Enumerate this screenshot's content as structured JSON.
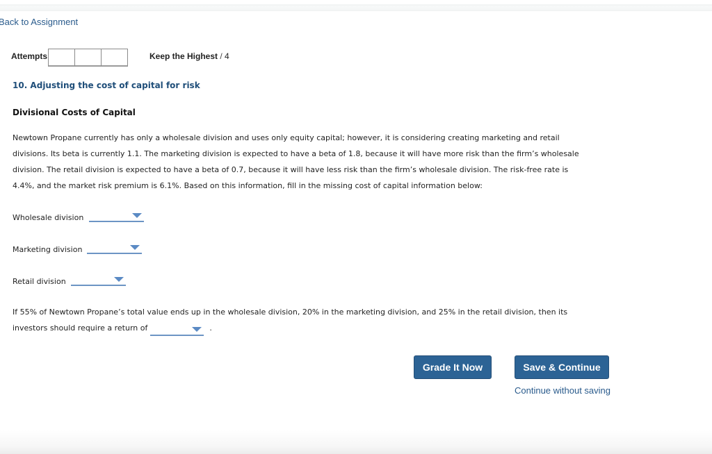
{
  "nav": {
    "back_link": "Back to Assignment"
  },
  "attempts": {
    "label": "Attempts",
    "boxes": [
      "",
      "",
      ""
    ],
    "policy_label": "Keep the Highest",
    "separator": " / ",
    "max_attempts": "4"
  },
  "question": {
    "title": "10. Adjusting the cost of capital for risk",
    "section_title": "Divisional Costs of Capital",
    "paragraph_lines": [
      "Newtown Propane currently has only a wholesale division and uses only equity capital; however, it is considering creating marketing and retail",
      "divisions. Its beta is currently 1.1. The marketing division is expected to have a beta of 1.8, because it will have more risk than the firm’s wholesale",
      "division. The retail division is expected to have a beta of 0.7, because it will have less risk than the firm’s wholesale division. The risk-free rate is",
      "4.4%, and the market risk premium is 6.1%. Based on this information, fill in the missing cost of capital information below:"
    ],
    "fields": [
      {
        "label": "Wholesale division",
        "selected": ""
      },
      {
        "label": "Marketing division",
        "selected": ""
      },
      {
        "label": "Retail division",
        "selected": ""
      }
    ],
    "weights_line1": "If 55% of Newtown Propane’s total value ends up in the wholesale division, 20% in the marketing division, and 25% in the retail division, then its",
    "weights_line2_prefix": "investors should require a return of",
    "weights_selected": "",
    "weights_suffix": "."
  },
  "actions": {
    "grade_button": "Grade It Now",
    "save_button": "Save & Continue",
    "continue_link": "Continue without saving"
  },
  "colors": {
    "link": "#2a5b8c",
    "title": "#1f4e79",
    "button": "#2c6395",
    "dropdown": "#5b8ac4"
  }
}
